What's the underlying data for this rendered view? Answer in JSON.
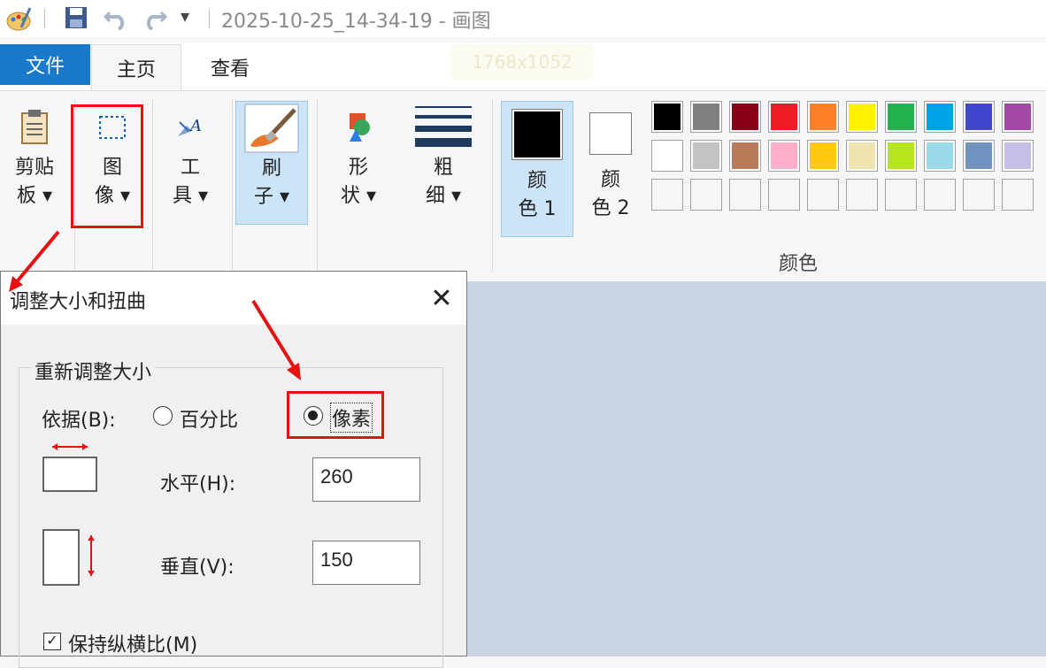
{
  "window": {
    "title": "2025-10-25_14-34-19 - 画图"
  },
  "quick_access": {
    "dropdown_glyph": "▾"
  },
  "tabs": [
    {
      "label": "文件"
    },
    {
      "label": "主页"
    },
    {
      "label": "查看"
    }
  ],
  "ghost_text": "1768x1052",
  "ribbon": {
    "clipboard": "剪贴\n板 ▾",
    "image": "图\n像 ▾",
    "tools": "工\n具 ▾",
    "brushes": "刷\n子 ▾",
    "shapes": "形\n状 ▾",
    "size": "粗\n细 ▾",
    "color1": "颜\n色 1",
    "color2": "颜\n色 2",
    "colors_group": "颜色"
  },
  "palette": {
    "row1": [
      "#000000",
      "#7f7f7f",
      "#880015",
      "#ed1c24",
      "#ff7f27",
      "#fff200",
      "#22b14c",
      "#00a2e8",
      "#3f48cc",
      "#a349a4"
    ],
    "row2": [
      "#ffffff",
      "#c3c3c3",
      "#b97a57",
      "#ffaec9",
      "#ffc90e",
      "#efe4b0",
      "#b5e61d",
      "#99d9ea",
      "#7092be",
      "#c8bfe7"
    ]
  },
  "dialog": {
    "title": "调整大小和扭曲",
    "close": "✕",
    "section": "重新调整大小",
    "by_label": "依据(B):",
    "percent_label": "百分比",
    "pixels_label": "像素",
    "horizontal_label": "水平(H):",
    "horizontal_value": "260",
    "vertical_label": "垂直(V):",
    "vertical_value": "150",
    "aspect_label": "保持纵横比(M)",
    "aspect_checked": true,
    "mode": "pixels"
  },
  "accent_colors": {
    "file_tab": "#1979ca",
    "annotation": "#e81010",
    "canvas": "#cad3e1"
  }
}
